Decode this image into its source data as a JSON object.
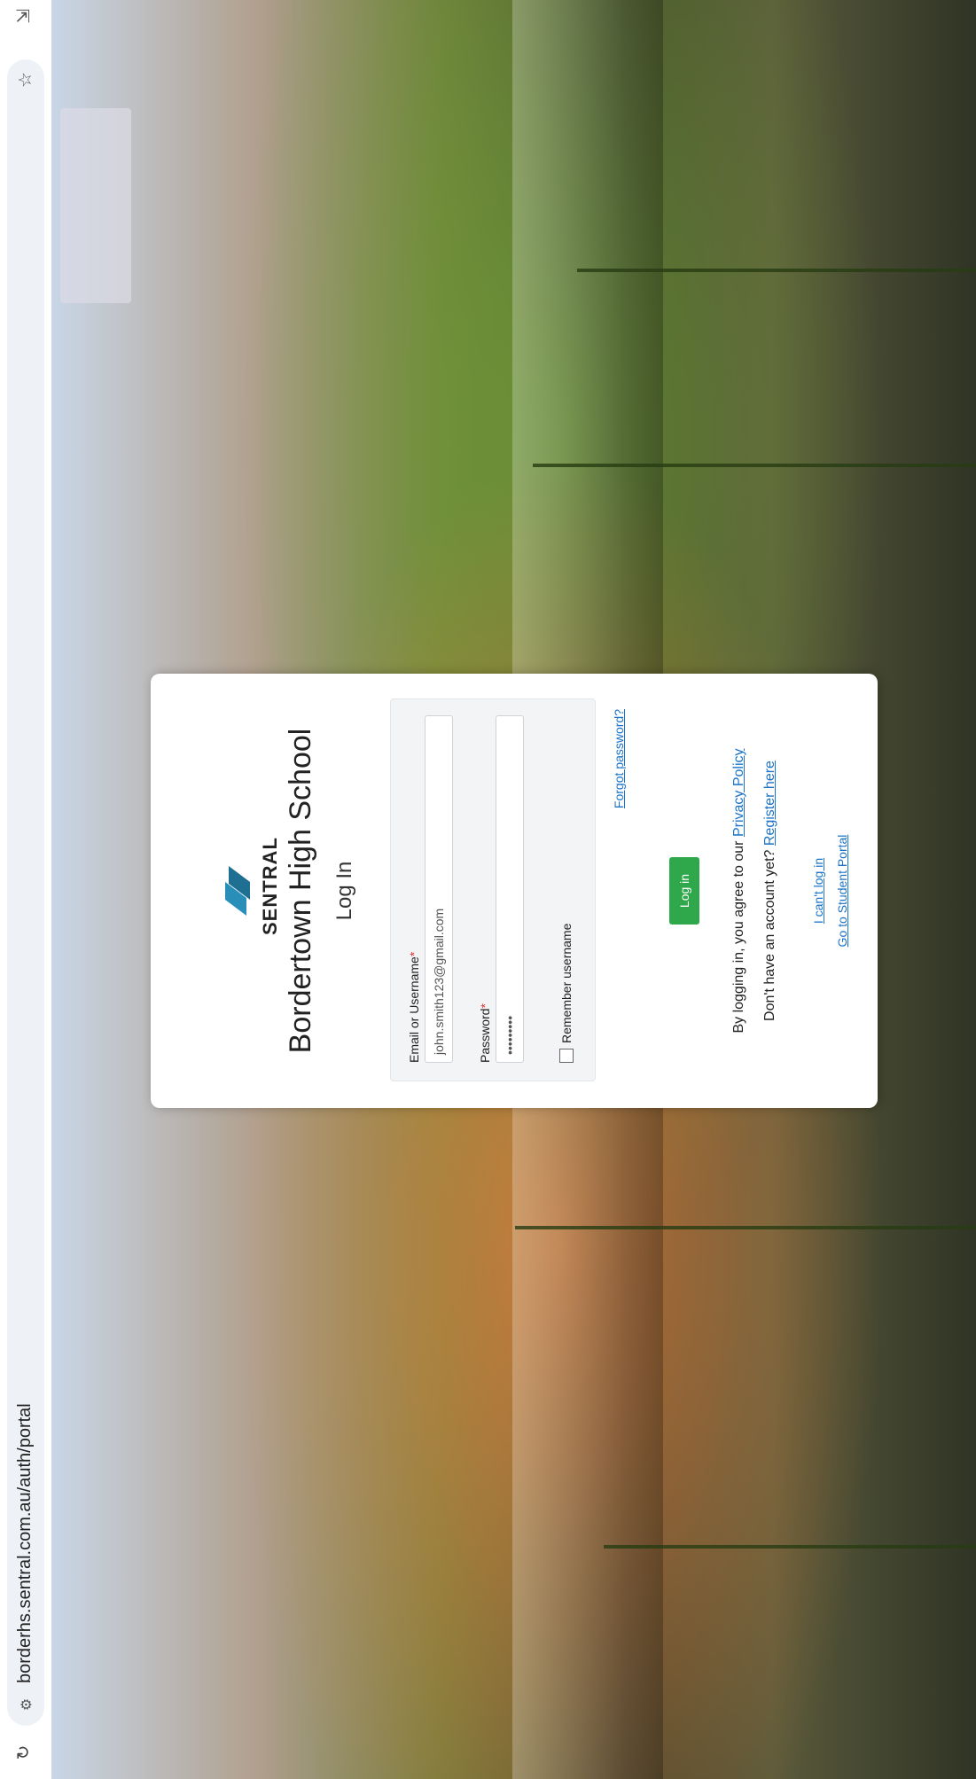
{
  "browser": {
    "url": "borderhs.sentral.com.au/auth/portal"
  },
  "brand": {
    "logo_text": "SENTRAL",
    "primary": "#2a8fb8",
    "accent": "#2ea84a"
  },
  "login": {
    "school_name": "Bordertown High School",
    "subtitle": "Log In",
    "username_label": "Email or Username",
    "username_value": "john.smith123@gmail.com",
    "password_label": "Password",
    "password_value": "•••••••••",
    "required_mark": "*",
    "remember_label": "Remember username",
    "forgot_text": "Forgot password?",
    "button": "Log in",
    "agree_text": "By logging in, you agree to our",
    "privacy_link": "Privacy Policy",
    "no_account_text": "Don't have an account yet?",
    "register_link": "Register here",
    "cant_login": "I can't log in",
    "student_portal": "Go to Student Portal"
  }
}
